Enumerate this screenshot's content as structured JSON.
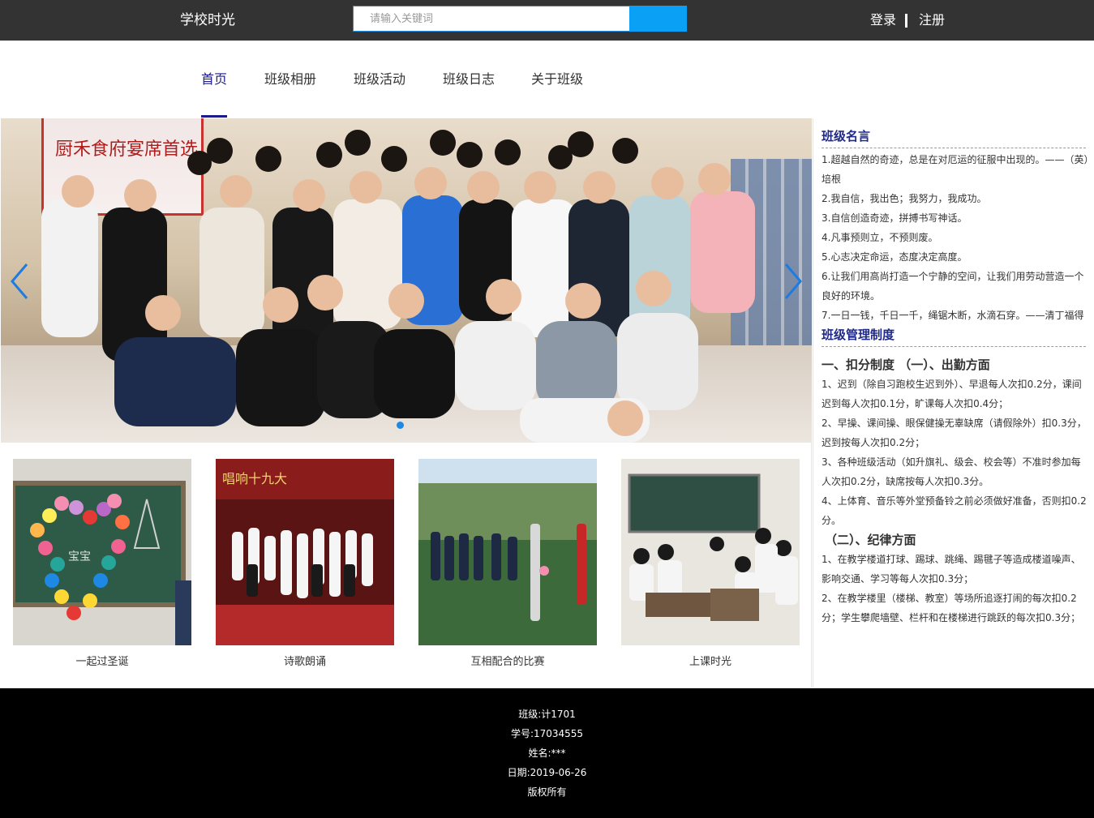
{
  "header": {
    "site_title": "学校时光",
    "search_placeholder": "请输入关键词",
    "login_label": "登录",
    "register_label": "注册"
  },
  "nav": {
    "items": [
      {
        "label": "首页",
        "active": true
      },
      {
        "label": "班级相册",
        "active": false
      },
      {
        "label": "班级活动",
        "active": false
      },
      {
        "label": "班级日志",
        "active": false
      },
      {
        "label": "关于班级",
        "active": false
      }
    ]
  },
  "banner": {
    "sign_text": "厨禾食府宴席首选"
  },
  "gallery": {
    "items": [
      {
        "caption": "一起过圣诞"
      },
      {
        "caption": "诗歌朗诵"
      },
      {
        "caption": "互相配合的比赛"
      },
      {
        "caption": "上课时光"
      }
    ]
  },
  "sidebar": {
    "mottos_title": "班级名言",
    "mottos": [
      "1.超越自然的奇迹，总是在对厄运的征服中出现的。——（英）培根",
      "2.我自信，我出色；我努力，我成功。",
      "3.自信创造奇迹，拼搏书写神话。",
      "4.凡事预则立，不预则废。",
      "5.心志决定命运，态度决定高度。",
      "6.让我们用高尚打造一个宁静的空间，让我们用劳动营造一个良好的环境。",
      "7.一日一钱，千日一千，绳锯木断，水滴石穿。——清丁福得"
    ],
    "rules_title": "班级管理制度",
    "rules_heading1": "一、扣分制度 （一）、出勤方面",
    "rules_attendance": [
      "1、迟到（除自习跑校生迟到外）、早退每人次扣0.2分，课间迟到每人次扣0.1分，旷课每人次扣0.4分；",
      "2、早操、课间操、眼保健操无辜缺席（请假除外）扣0.3分，迟到按每人次扣0.2分；",
      "3、各种班级活动（如升旗礼、级会、校会等）不准时参加每人次扣0.2分，缺席按每人次扣0.3分。",
      "4、上体育、音乐等外堂预备铃之前必须做好准备，否则扣0.2分。"
    ],
    "rules_heading2": "（二）、纪律方面",
    "rules_discipline": [
      "1、在教学楼道打球、踢球、跳绳、踢毽子等造成楼道噪声、影响交通、学习等每人次扣0.3分；",
      "2、在教学楼里（楼梯、教室）等场所追逐打闹的每次扣0.2分；学生攀爬墙壁、栏杆和在楼梯进行跳跃的每次扣0.3分；"
    ]
  },
  "footer": {
    "class": "班级:计1701",
    "student_id": "学号:17034555",
    "name": "姓名:***",
    "date": "日期:2019-06-26",
    "copyright": "版权所有"
  }
}
